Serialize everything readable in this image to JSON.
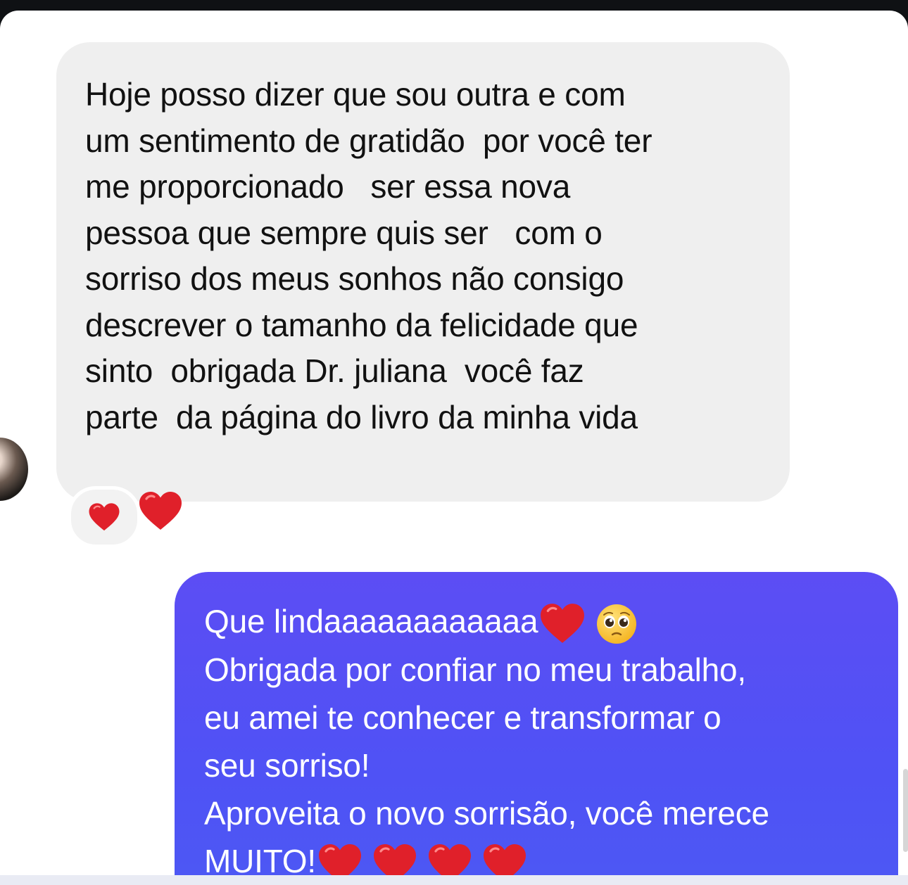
{
  "conversation": {
    "received_message": {
      "lines": [
        "Hoje posso dizer que sou outra e com",
        "um sentimento de gratidão  por você ter",
        "me proporcionado   ser essa nova",
        "pessoa que sempre quis ser   com o",
        "sorriso dos meus sonhos não consigo",
        "descrever o tamanho da felicidade que",
        "sinto  obrigada Dr. juliana  você faz",
        "parte  da página do livro da minha vida"
      ],
      "trailing_emoji": "red-heart-icon",
      "reaction_emoji": "red-heart-icon"
    },
    "sent_message": {
      "line1_text": "Que lindaaaaaaaaaaaa",
      "line1_emojis": [
        "red-heart-icon",
        "pleading-face-icon"
      ],
      "lines": [
        "Obrigada por confiar no meu trabalho,",
        "eu amei te conhecer e transformar o",
        "seu sorriso!",
        "Aproveita o novo sorrisão, você merece"
      ],
      "last_line_text": "MUITO!",
      "last_line_emojis": [
        "red-heart-icon",
        "red-heart-icon",
        "red-heart-icon",
        "red-heart-icon"
      ]
    }
  },
  "colors": {
    "received_bubble": "#efefef",
    "sent_bubble": "#5250f5",
    "heart": "#e0202a"
  }
}
